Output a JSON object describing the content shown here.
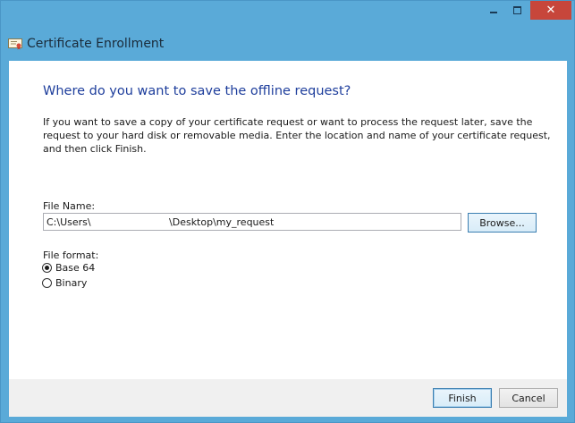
{
  "window": {
    "title": "Certificate Enrollment",
    "controls": {
      "minimize": "minimize",
      "maximize": "maximize",
      "close": "✕"
    }
  },
  "page": {
    "heading": "Where do you want to save the offline request?",
    "description": "If you want to save a copy of your certificate request or want to process the request later, save the request to your hard disk or removable media. Enter the location and name of your certificate request, and then click Finish."
  },
  "file_name": {
    "label": "File Name:",
    "value": "C:\\Users\\                         \\Desktop\\my_request",
    "browse_label": "Browse..."
  },
  "file_format": {
    "label": "File format:",
    "options": [
      {
        "label": "Base 64",
        "selected": true
      },
      {
        "label": "Binary",
        "selected": false
      }
    ]
  },
  "footer": {
    "finish_label": "Finish",
    "cancel_label": "Cancel"
  },
  "colors": {
    "frame": "#5aaad8",
    "heading": "#1e3e9c",
    "close_button": "#c7463b"
  }
}
